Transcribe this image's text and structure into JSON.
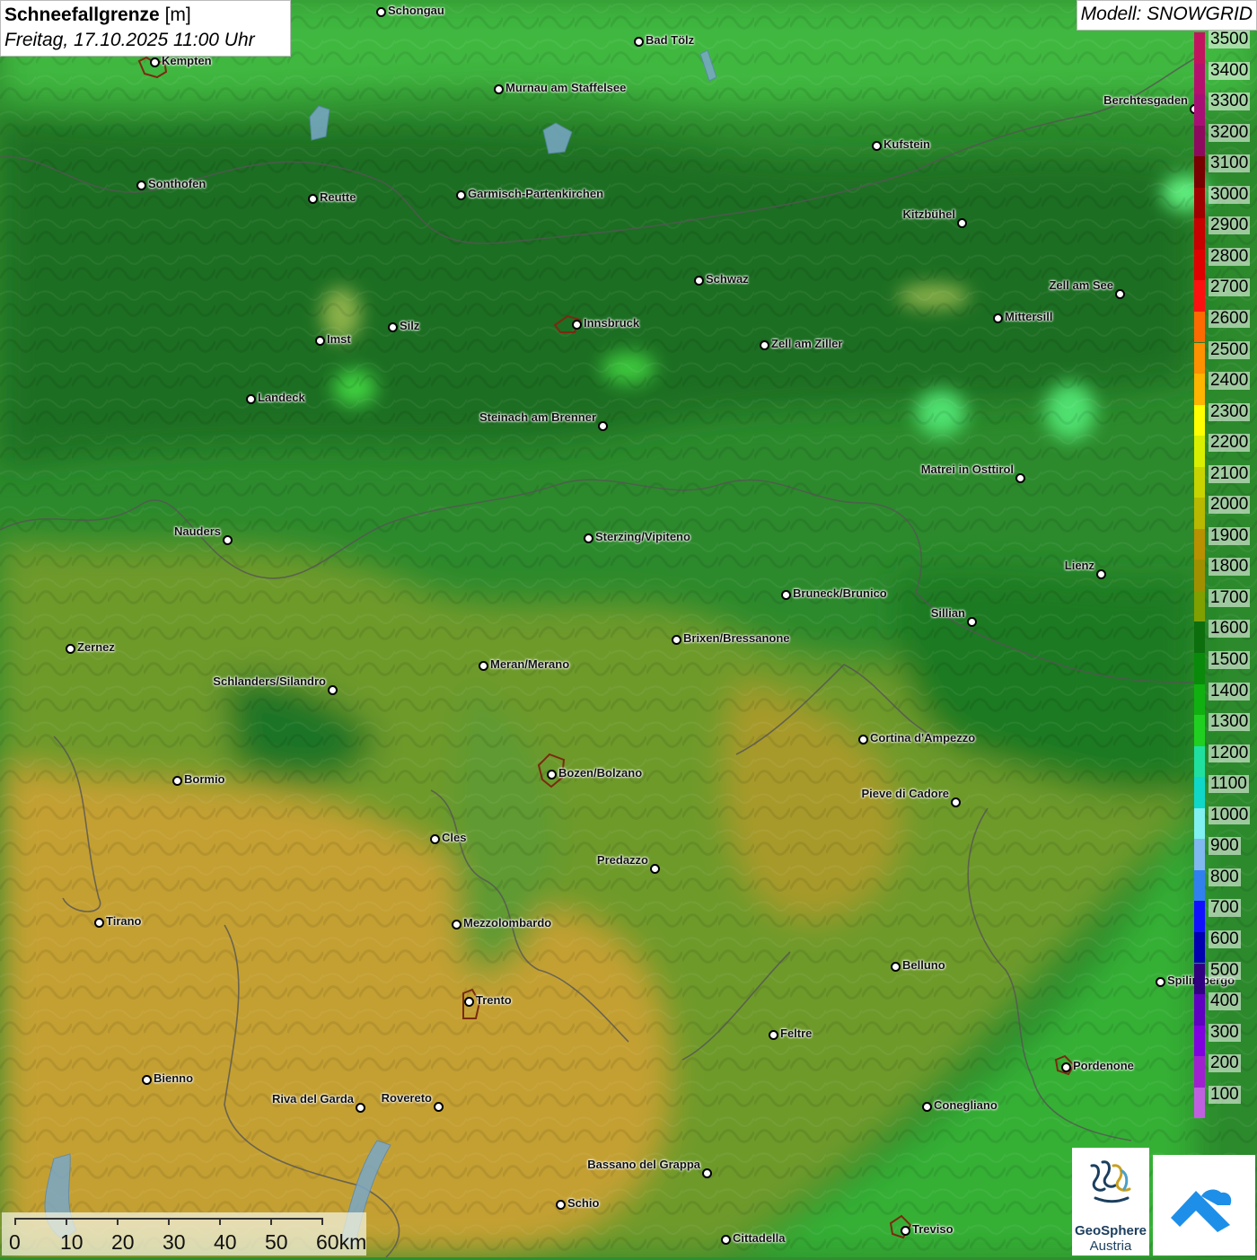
{
  "title": {
    "name": "Schneefallgrenze",
    "unit": "[m]",
    "datetime": "Freitag, 17.10.2025 11:00 Uhr"
  },
  "model_label": "Modell: SNOWGRID",
  "legend": [
    {
      "label": "3500",
      "color": "#c2145e"
    },
    {
      "label": "3400",
      "color": "#b5106e"
    },
    {
      "label": "3300",
      "color": "#a80f74"
    },
    {
      "label": "3200",
      "color": "#8e0a5e"
    },
    {
      "label": "3100",
      "color": "#780000"
    },
    {
      "label": "3000",
      "color": "#a00000"
    },
    {
      "label": "2900",
      "color": "#c80000"
    },
    {
      "label": "2800",
      "color": "#e00000"
    },
    {
      "label": "2700",
      "color": "#ff1010"
    },
    {
      "label": "2600",
      "color": "#ff6a00"
    },
    {
      "label": "2500",
      "color": "#ff9000"
    },
    {
      "label": "2400",
      "color": "#ffb400"
    },
    {
      "label": "2300",
      "color": "#ffff00"
    },
    {
      "label": "2200",
      "color": "#d8f000"
    },
    {
      "label": "2100",
      "color": "#c8d400"
    },
    {
      "label": "2000",
      "color": "#b8b800"
    },
    {
      "label": "1900",
      "color": "#b89000"
    },
    {
      "label": "1800",
      "color": "#a09000"
    },
    {
      "label": "1700",
      "color": "#80a000"
    },
    {
      "label": "1600",
      "color": "#0c6e0c"
    },
    {
      "label": "1500",
      "color": "#0a8a0a"
    },
    {
      "label": "1400",
      "color": "#10b010"
    },
    {
      "label": "1300",
      "color": "#20d020"
    },
    {
      "label": "1200",
      "color": "#20e0a0"
    },
    {
      "label": "1100",
      "color": "#10d8c8"
    },
    {
      "label": "1000",
      "color": "#80f0f0"
    },
    {
      "label": "900",
      "color": "#80b8f0"
    },
    {
      "label": "800",
      "color": "#3080f0"
    },
    {
      "label": "700",
      "color": "#1010ff"
    },
    {
      "label": "600",
      "color": "#0000b0"
    },
    {
      "label": "500",
      "color": "#300080"
    },
    {
      "label": "400",
      "color": "#6000c0"
    },
    {
      "label": "300",
      "color": "#8000e0"
    },
    {
      "label": "200",
      "color": "#a020d0"
    },
    {
      "label": "100",
      "color": "#c060e0"
    }
  ],
  "cities": [
    {
      "name": "Schongau",
      "side": "right"
    },
    {
      "name": "Bad Tölz",
      "side": "right"
    },
    {
      "name": "Kempten",
      "side": "right"
    },
    {
      "name": "Murnau am Staffelsee",
      "side": "right"
    },
    {
      "name": "Berchtesgaden",
      "side": "left"
    },
    {
      "name": "Kufstein",
      "side": "right"
    },
    {
      "name": "Sonthofen",
      "side": "right"
    },
    {
      "name": "Reutte",
      "side": "right"
    },
    {
      "name": "Garmisch-Partenkirchen",
      "side": "right"
    },
    {
      "name": "Kitzbühel",
      "side": "left"
    },
    {
      "name": "Schwaz",
      "side": "right"
    },
    {
      "name": "Zell am See",
      "side": "left"
    },
    {
      "name": "Mittersill",
      "side": "right"
    },
    {
      "name": "Silz",
      "side": "right"
    },
    {
      "name": "Innsbruck",
      "side": "right"
    },
    {
      "name": "Imst",
      "side": "right"
    },
    {
      "name": "Zell am Ziller",
      "side": "right"
    },
    {
      "name": "Landeck",
      "side": "right"
    },
    {
      "name": "Steinach am Brenner",
      "side": "left"
    },
    {
      "name": "Matrei in Osttirol",
      "side": "left"
    },
    {
      "name": "Nauders",
      "side": "left"
    },
    {
      "name": "Sterzing/Vipiteno",
      "side": "right"
    },
    {
      "name": "Lienz",
      "side": "left"
    },
    {
      "name": "Bruneck/Brunico",
      "side": "right"
    },
    {
      "name": "Sillian",
      "side": "left"
    },
    {
      "name": "Zernez",
      "side": "right"
    },
    {
      "name": "Brixen/Bressanone",
      "side": "right"
    },
    {
      "name": "Meran/Merano",
      "side": "right"
    },
    {
      "name": "Schlanders/Silandro",
      "side": "left"
    },
    {
      "name": "Cortina d'Ampezzo",
      "side": "right"
    },
    {
      "name": "Bozen/Bolzano",
      "side": "right"
    },
    {
      "name": "Bormio",
      "side": "right"
    },
    {
      "name": "Pieve di Cadore",
      "side": "left"
    },
    {
      "name": "Cles",
      "side": "right"
    },
    {
      "name": "Predazzo",
      "side": "left"
    },
    {
      "name": "Tirano",
      "side": "right"
    },
    {
      "name": "Mezzolombardo",
      "side": "right"
    },
    {
      "name": "Belluno",
      "side": "right"
    },
    {
      "name": "Spilimbergo",
      "side": "right"
    },
    {
      "name": "Trento",
      "side": "right"
    },
    {
      "name": "Feltre",
      "side": "right"
    },
    {
      "name": "Pordenone",
      "side": "right"
    },
    {
      "name": "Bienno",
      "side": "right"
    },
    {
      "name": "Riva del Garda",
      "side": "left"
    },
    {
      "name": "Rovereto",
      "side": "left"
    },
    {
      "name": "Conegliano",
      "side": "right"
    },
    {
      "name": "Bassano del Grappa",
      "side": "left"
    },
    {
      "name": "Schio",
      "side": "right"
    },
    {
      "name": "Treviso",
      "side": "right"
    },
    {
      "name": "Cittadella",
      "side": "right"
    }
  ],
  "scalebar": {
    "labels": [
      "0",
      "10",
      "20",
      "30",
      "40",
      "50",
      "60km"
    ]
  },
  "logos": {
    "geosphere_line1": "GeoSphere",
    "geosphere_line2": "Austria"
  }
}
